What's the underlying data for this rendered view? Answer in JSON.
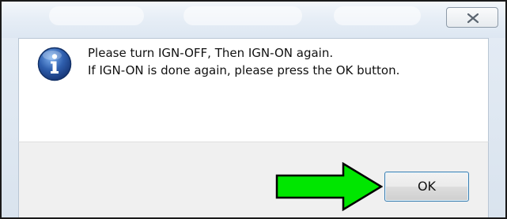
{
  "dialog": {
    "message_line_1": "Please turn IGN-OFF, Then IGN-ON again.",
    "message_line_2": "If IGN-ON is done again, please press the OK button.",
    "ok_label": "OK"
  },
  "icons": {
    "info": "information-icon",
    "close": "close-icon",
    "arrow": "arrow-right-icon"
  },
  "colors": {
    "arrow_fill": "#00e600",
    "info_blue": "#2f5fae"
  }
}
